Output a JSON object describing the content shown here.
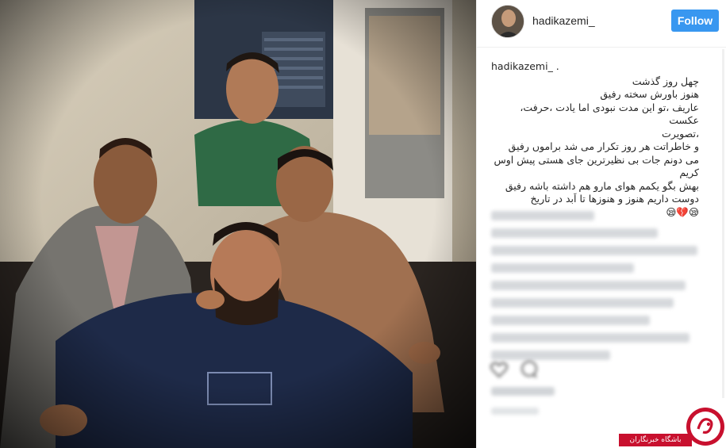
{
  "photo": {
    "alt_desc": ""
  },
  "header": {
    "username": "hadikazemi_",
    "follow_label": "Follow"
  },
  "caption": {
    "username": "hadikazemi_ .",
    "lines": [
      "چهل روز گذشت",
      "هنوز باورش سخته رفیق",
      "عاریف ،تو این مدت نبودی اما یادت ،حرفت، عکست",
      "،تصویرت",
      "و خاطراتت هر روز تکرار می شد براموں رفیق",
      "می دونم جات بی نظیرترین جای هستی پیش اوس کریم",
      "بهش بگو یکمم هوای مارو هم داشته باشه رفیق",
      "دوست داریم هنوز و هنوزها تا اَبد در تاریخ",
      "😪💔😪"
    ]
  },
  "icons": {
    "like": "heart-icon",
    "comment": "comment-icon"
  },
  "watermark": {
    "label": "باشگاه خبرنگاران",
    "logo": "yjc-logo-icon",
    "color": "#c8102e"
  },
  "colors": {
    "follow": "#3897f0",
    "text": "#262626"
  }
}
